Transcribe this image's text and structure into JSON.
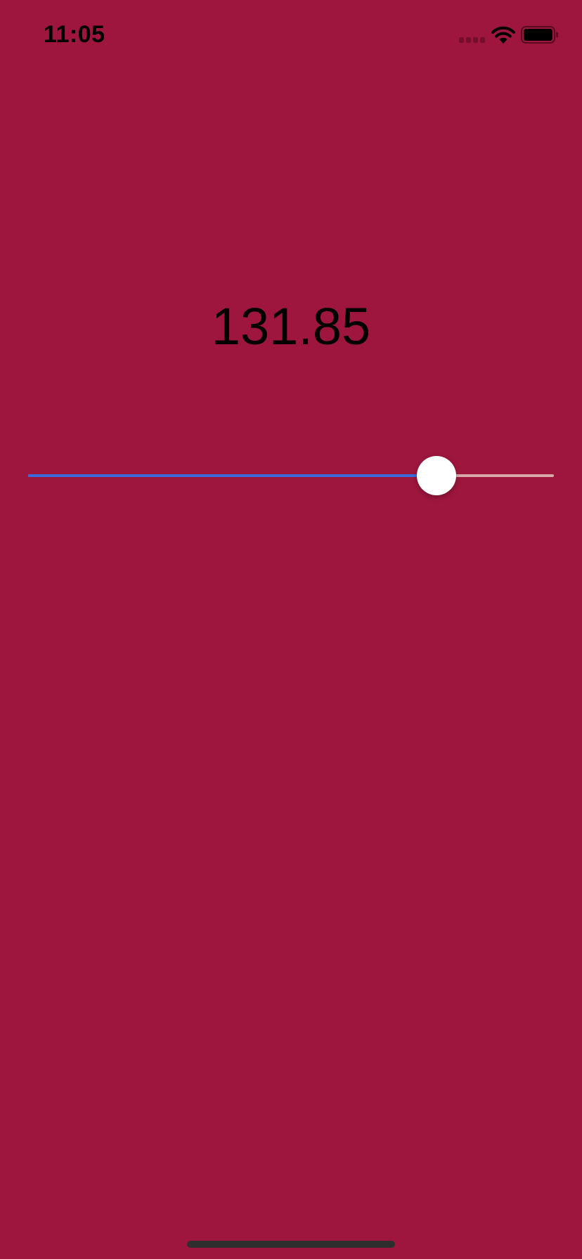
{
  "status_bar": {
    "time": "11:05",
    "icons": [
      "cell-signal-icon",
      "wifi-icon",
      "battery-icon"
    ]
  },
  "value_label": "131.85",
  "slider": {
    "value_fraction": 0.777,
    "fill_color": "#3a6bdc",
    "track_color": "#d9a9a9",
    "thumb_color": "#ffffff"
  },
  "colors": {
    "background": "#9e163e"
  }
}
